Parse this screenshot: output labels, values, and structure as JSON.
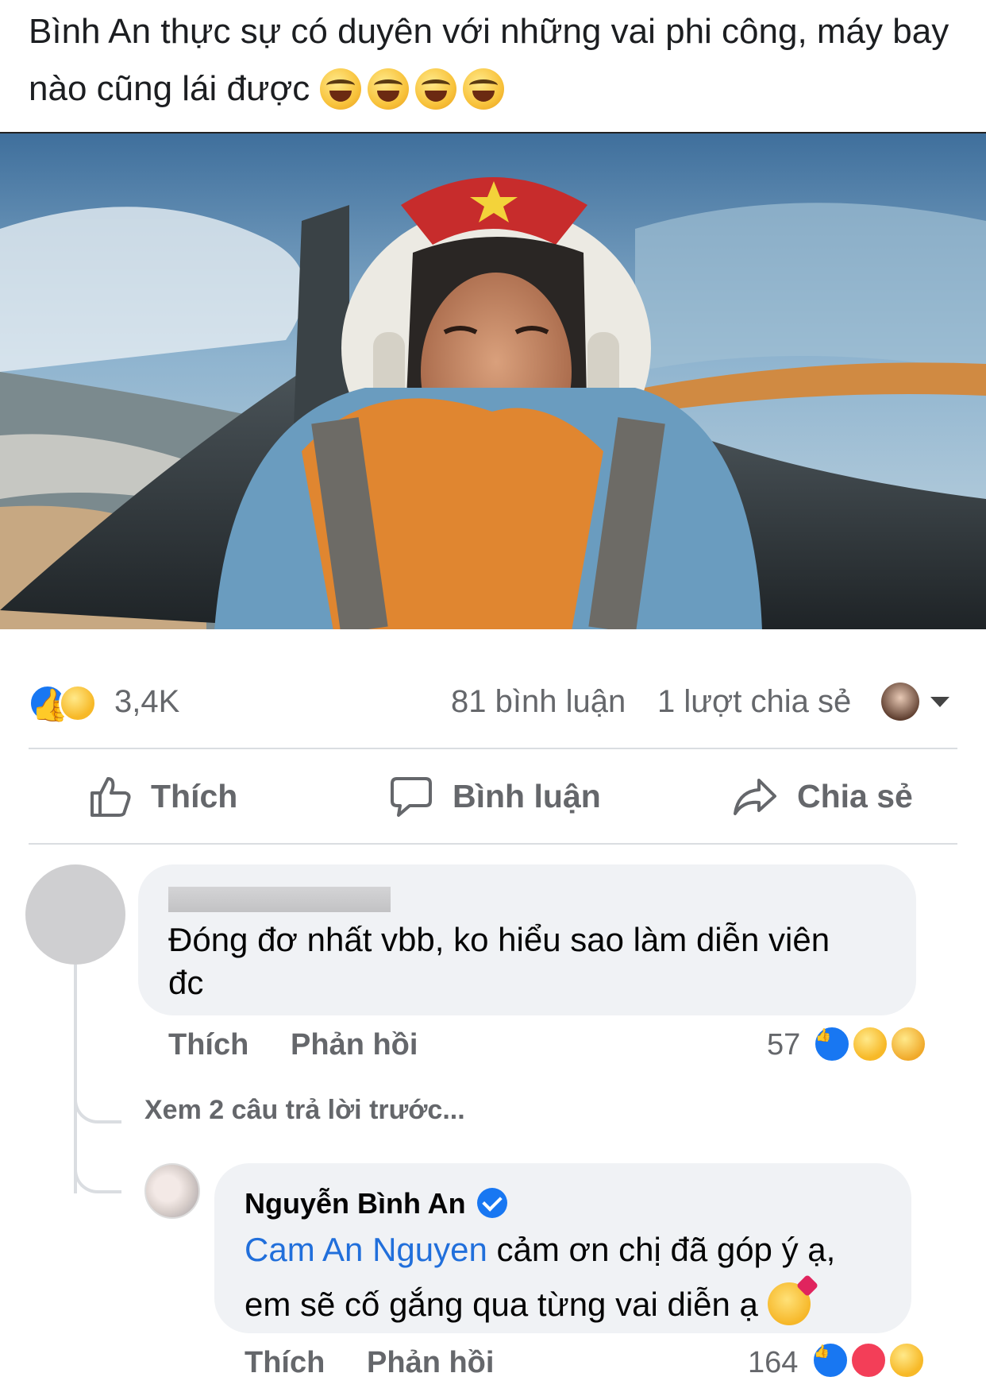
{
  "post": {
    "text": "Bình An thực sự có duyên với những vai phi công, máy bay nào cũng lái được",
    "emoji_count": 4
  },
  "stats": {
    "reaction_count": "3,4K",
    "comments": "81 bình luận",
    "shares": "1 lượt chia sẻ"
  },
  "actions": {
    "like": "Thích",
    "comment": "Bình luận",
    "share": "Chia sẻ"
  },
  "comment1": {
    "text_line1": "Đóng đơ nhất vbb, ko hiểu sao làm diễn viên",
    "text_line2": "đc",
    "like": "Thích",
    "reply": "Phản hồi",
    "reaction_count": "57"
  },
  "view_more": "Xem 2 câu trả lời trước...",
  "reply1": {
    "author": "Nguyễn Bình An",
    "mention": "Cam An Nguyen",
    "text_line1": " cảm ơn chị đã góp ý ạ,",
    "text_line2": "em sẽ cố gắng qua từng vai diễn ạ",
    "like": "Thích",
    "reply": "Phản hồi",
    "reaction_count": "164"
  },
  "colors": {
    "facebook_blue": "#1877f2",
    "mention": "#216fdb",
    "secondary_text": "#65676b",
    "bubble": "#f0f2f5"
  }
}
